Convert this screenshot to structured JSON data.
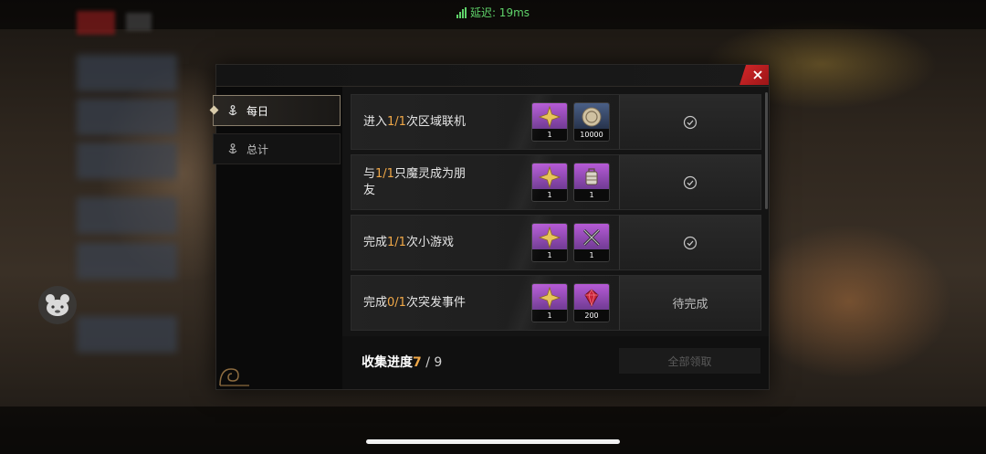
{
  "status_bar": {
    "latency_text": "延迟: 19ms",
    "color": "#5fd36a"
  },
  "dialog": {
    "tabs": [
      {
        "label": "每日",
        "active": true,
        "icon": "anchor-icon"
      },
      {
        "label": "总计",
        "active": false,
        "icon": "anchor-icon"
      }
    ],
    "tasks": [
      {
        "prefix": "进入",
        "progress": "1/1",
        "suffix": "次区域联机",
        "rewards": [
          {
            "icon": "gold-star-emblem-icon",
            "count": "1"
          },
          {
            "icon": "coin-icon",
            "count": "10000"
          }
        ],
        "state": "completed",
        "state_icon": "check-circle-icon"
      },
      {
        "prefix": "与",
        "progress": "1/1",
        "suffix": "只魔灵成为朋友",
        "rewards": [
          {
            "icon": "gold-star-emblem-icon",
            "count": "1"
          },
          {
            "icon": "lantern-item-icon",
            "count": "1"
          }
        ],
        "state": "completed",
        "state_icon": "check-circle-icon"
      },
      {
        "prefix": "完成",
        "progress": "1/1",
        "suffix": "次小游戏",
        "rewards": [
          {
            "icon": "gold-star-emblem-icon",
            "count": "1"
          },
          {
            "icon": "crossed-tools-icon",
            "count": "1"
          }
        ],
        "state": "completed",
        "state_icon": "check-circle-icon"
      },
      {
        "prefix": "完成",
        "progress": "0/1",
        "suffix": "次突发事件",
        "rewards": [
          {
            "icon": "gold-star-emblem-icon",
            "count": "1"
          },
          {
            "icon": "red-gem-icon",
            "count": "200"
          }
        ],
        "state": "pending",
        "state_label": "待完成"
      }
    ],
    "footer": {
      "progress_label": "收集进度",
      "progress_current": "7",
      "progress_total": " / 9",
      "claim_all_label": "全部领取"
    }
  },
  "colors": {
    "highlight": "#f0a848",
    "close": "#d3282a",
    "rare_purple": "#b65bd6",
    "rare_blue": "#4a5f86"
  }
}
